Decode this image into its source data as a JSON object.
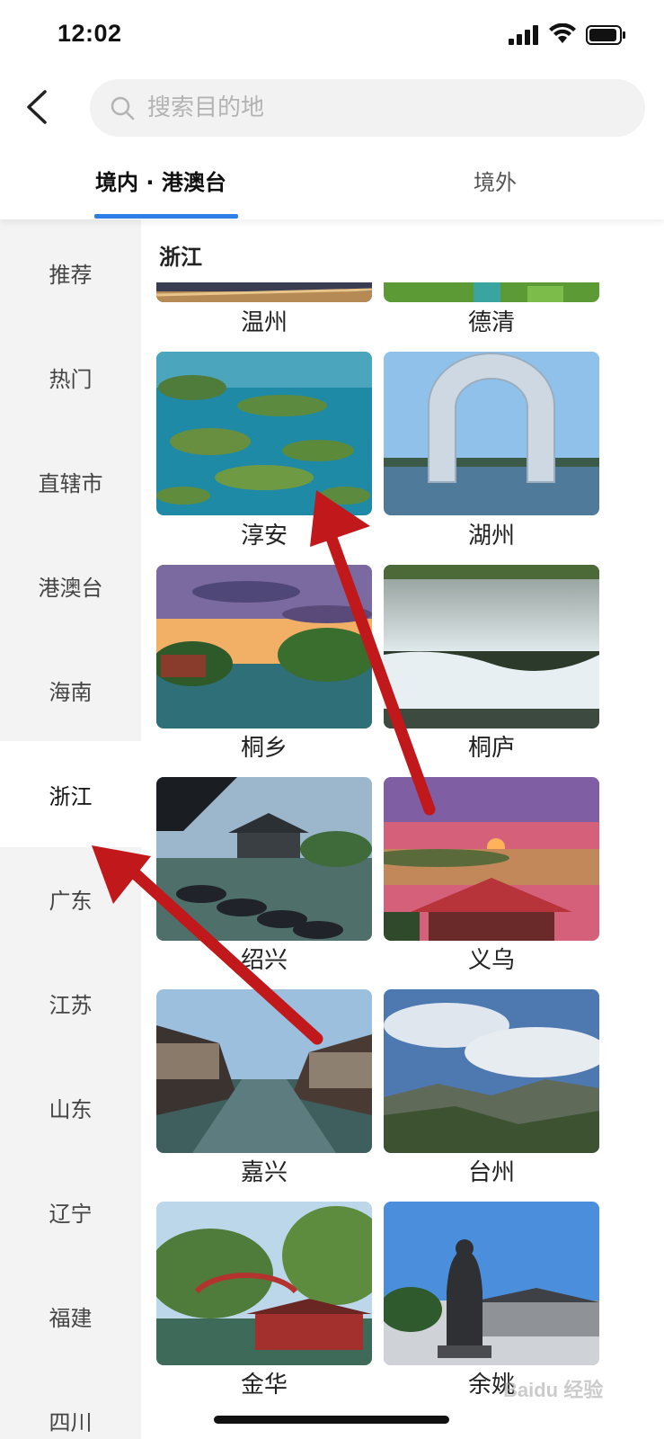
{
  "status_bar": {
    "time": "12:02"
  },
  "search": {
    "placeholder": "搜索目的地"
  },
  "tabs": [
    {
      "label": "境内 · 港澳台",
      "active": true
    },
    {
      "label": "境外",
      "active": false
    }
  ],
  "sidebar": {
    "items": [
      {
        "label": "推荐"
      },
      {
        "label": "热门"
      },
      {
        "label": "直辖市"
      },
      {
        "label": "港澳台"
      },
      {
        "label": "海南"
      },
      {
        "label": "浙江",
        "active": true
      },
      {
        "label": "广东"
      },
      {
        "label": "江苏"
      },
      {
        "label": "山东"
      },
      {
        "label": "辽宁"
      },
      {
        "label": "福建"
      },
      {
        "label": "四川"
      }
    ]
  },
  "section": {
    "title": "浙江"
  },
  "cities": [
    {
      "name": "温州"
    },
    {
      "name": "德清"
    },
    {
      "name": "淳安"
    },
    {
      "name": "湖州"
    },
    {
      "name": "桐乡"
    },
    {
      "name": "桐庐"
    },
    {
      "name": "绍兴"
    },
    {
      "name": "义乌"
    },
    {
      "name": "嘉兴"
    },
    {
      "name": "台州"
    },
    {
      "name": "金华"
    },
    {
      "name": "余姚"
    }
  ],
  "annotation_color": "#c0181b",
  "accent_color": "#2f7ee8",
  "watermark": "Baidu 经验"
}
